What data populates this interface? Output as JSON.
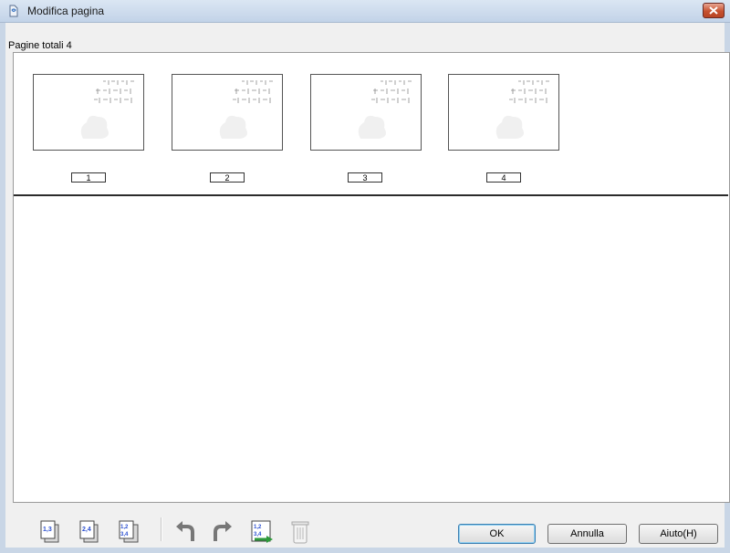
{
  "window": {
    "title": "Modifica pagina"
  },
  "header": {
    "total_pages_label": "Pagine totali 4"
  },
  "thumbnails": [
    {
      "page_number": "1"
    },
    {
      "page_number": "2"
    },
    {
      "page_number": "3"
    },
    {
      "page_number": "4"
    }
  ],
  "toolbar": {
    "icons": [
      "odd-pages-icon",
      "even-pages-icon",
      "all-pages-icon",
      "rotate-left-icon",
      "rotate-right-icon",
      "reorder-pages-icon",
      "delete-icon"
    ]
  },
  "buttons": {
    "ok": "OK",
    "cancel": "Annulla",
    "help": "Aiuto(H)"
  },
  "colors": {
    "accent_blue": "#2a4fd0",
    "arrow_green": "#2f9a3b",
    "close_red": "#c6512f"
  }
}
